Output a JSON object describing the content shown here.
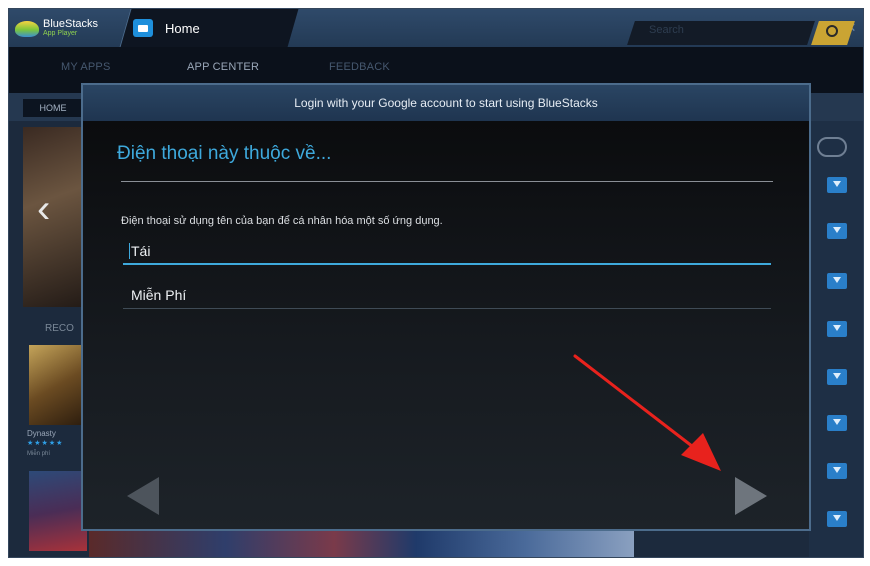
{
  "titlebar": {
    "app_name": "BlueStacks",
    "app_subtitle": "App Player",
    "tab_label": "Home"
  },
  "navbar": {
    "items": [
      "MY APPS",
      "APP CENTER",
      "FEEDBACK"
    ],
    "search_placeholder": "Search"
  },
  "background": {
    "subnav_home": "HOME",
    "recommended_label": "RECO",
    "thumb_title": "Dynasty",
    "thumb_stars": "★★★★★",
    "thumb_free": "Miễn phí"
  },
  "dialog": {
    "header": "Login with your Google account to start using BlueStacks",
    "heading": "Điện thoại này thuộc về...",
    "description": "Điện thoại sử dụng tên của bạn để cá nhân hóa một số ứng dụng.",
    "first_name": "Tái",
    "last_name": "Miễn Phí"
  },
  "colors": {
    "accent": "#3ea9dc",
    "annotation_arrow": "#e8221d"
  }
}
